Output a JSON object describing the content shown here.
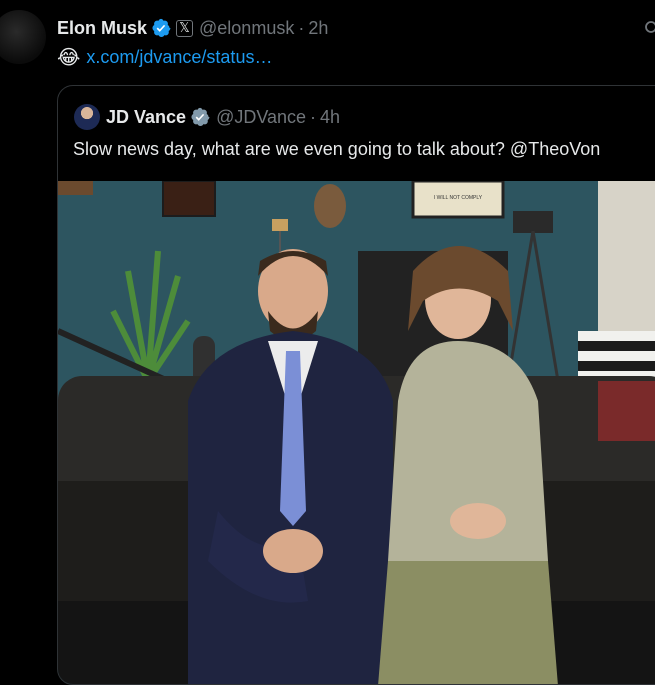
{
  "tweet": {
    "author_name": "Elon Musk",
    "author_handle": "@elonmusk",
    "separator": "·",
    "time": "2h",
    "emoji": "😂",
    "link_text": "x.com/jdvance/status…",
    "affiliate_badge": "𝕏"
  },
  "quote": {
    "author_name": "JD Vance",
    "author_handle": "@JDVance",
    "separator": "·",
    "time": "4h",
    "text": "Slow news day, what are we even going to talk about? @TheoVon",
    "photo_sign": "I WILL NOT COMPLY"
  },
  "colors": {
    "background": "#000000",
    "text": "#e7e9ea",
    "muted": "#71767b",
    "link": "#1d9bf0",
    "verified": "#1d9bf0",
    "verified_gray": "#829aab",
    "border": "#2f3336"
  },
  "icons": [
    "verified-badge-icon",
    "x-affiliate-icon",
    "search-icon",
    "laughing-emoji-icon"
  ]
}
